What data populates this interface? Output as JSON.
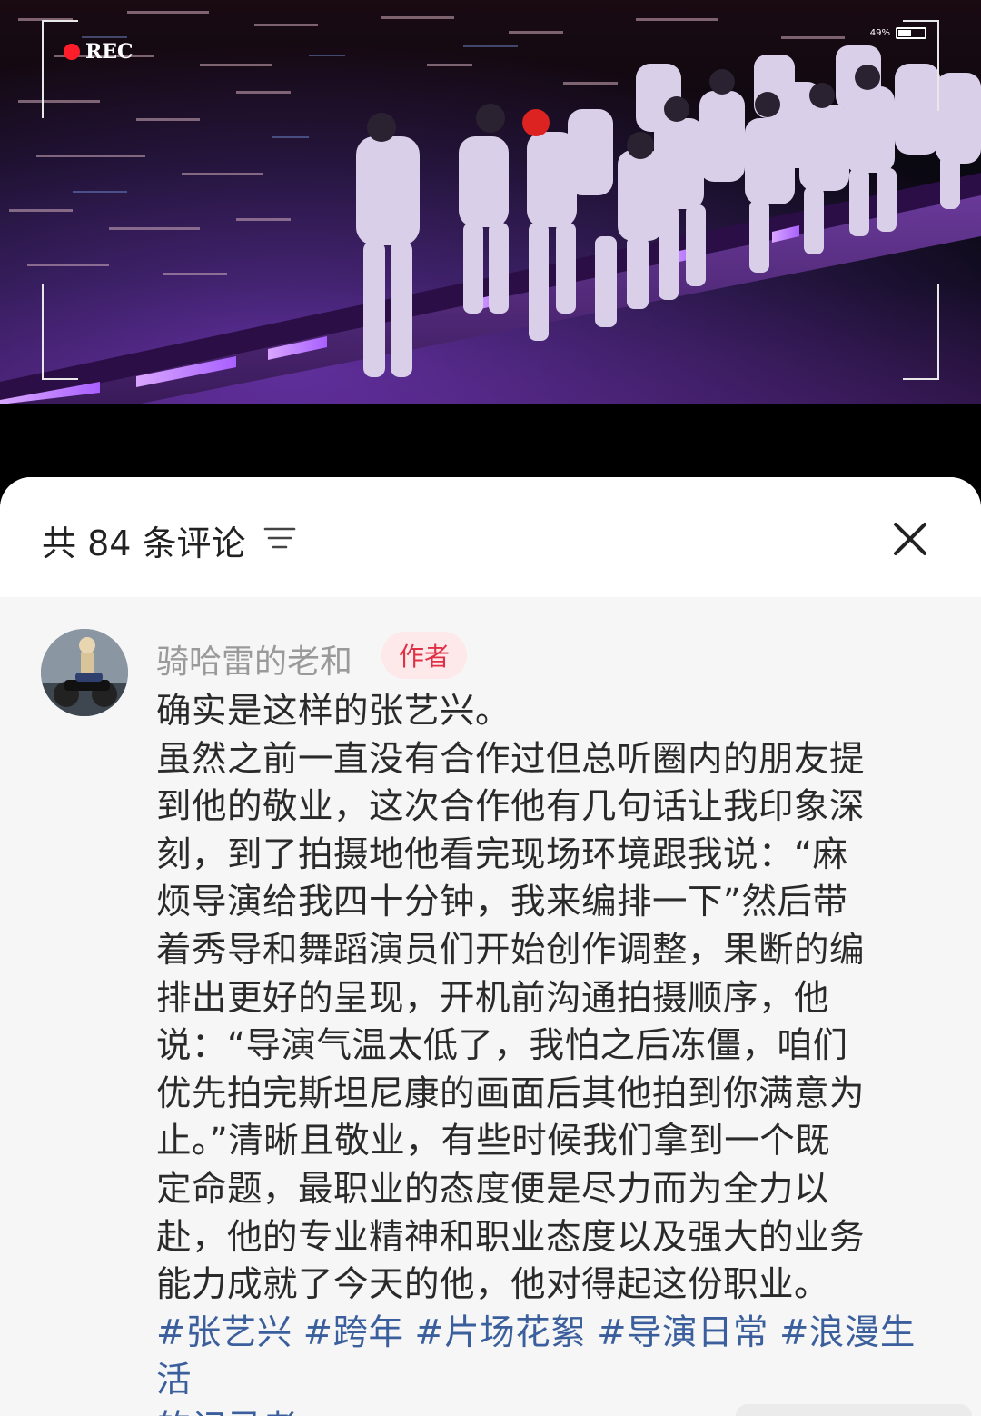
{
  "video": {
    "rec_label": "REC",
    "battery_label": "49%",
    "battery_level": 0.49,
    "colors": {
      "stage_light": "#b86cff",
      "rec_dot": "#ff1d2a"
    }
  },
  "sheet": {
    "title": "共 84 条评论",
    "sort_icon": "sort-lines-icon",
    "close_icon": "close-x-icon"
  },
  "comment": {
    "username": "骑哈雷的老和",
    "badge": "作者",
    "lines": [
      "确实是这样的张艺兴。",
      "虽然之前一直没有合作过但总听圈内的朋友提",
      "到他的敬业，这次合作他有几句话让我印象深",
      "刻，到了拍摄地他看完现场环境跟我说：“麻",
      "烦导演给我四十分钟，我来编排一下”然后带",
      "着秀导和舞蹈演员们开始创作调整，果断的编",
      "排出更好的呈现，开机前沟通拍摄顺序，他",
      "说：“导演气温太低了，我怕之后冻僵，咱们",
      "优先拍完斯坦尼康的画面后其他拍到你满意为",
      "止。”清晰且敬业，有些时候我们拿到一个既",
      "定命题，最职业的态度便是尽力而为全力以",
      "赴，他的专业精神和职业态度以及强大的业务",
      "能力成就了今天的他，他对得起这份职业。"
    ],
    "hashtags": [
      "#张艺兴",
      "#跨年",
      "#片场花絮",
      "#导演日常",
      "#浪漫生活"
    ],
    "hashtags_tail": "的记录者",
    "colors": {
      "link": "#3b5f9c",
      "badge_text": "#e03046",
      "badge_bg": "#fde8ea"
    }
  }
}
